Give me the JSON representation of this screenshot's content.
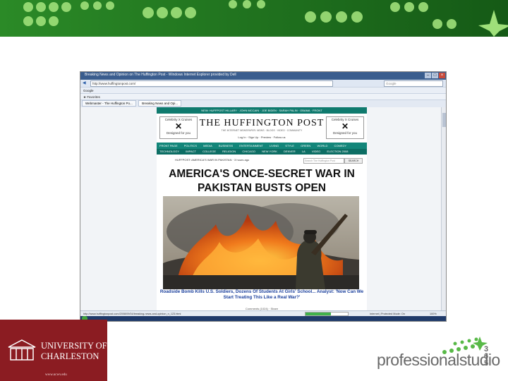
{
  "browser": {
    "title": "Breaking News and Opinion on The Huffington Post - Windows Internet Explorer provided by Dell",
    "address": "http://www.huffingtonpost.com/",
    "search_placeholder": "Google",
    "tabs": [
      {
        "label": "Webmaster - The Huffington Po..."
      },
      {
        "label": "Breaking News and Opi..."
      }
    ],
    "toolbar_label": "Google",
    "favorites_label": "Favorites",
    "status_url": "http://www.huffingtonpost.com/2008/09/04/breaking-news-and-opinion_n_123.html",
    "zone": "Internet | Protected Mode: On",
    "zoom": "100%",
    "load_progress": 0.6
  },
  "site": {
    "top_nav": "NEW: HUFFPOST HILLARY · JOHN MCCAIN · JOE BIDEN · SARAH PALIN · OBAMA · FRONT",
    "ads": [
      {
        "brand": "Celebrity X Cruises",
        "line": "Designed for you"
      },
      {
        "brand": "Celebrity X Cruises",
        "line": "Designed for you"
      }
    ],
    "logo": "THE HUFFINGTON POST",
    "tagline": "THE INTERNET NEWSPAPER: NEWS · BLOGS · VIDEO · COMMUNITY",
    "login": "Log In · Sign Up · Preview · Follow us",
    "sections": [
      "FRONT PAGE",
      "POLITICS",
      "MEDIA",
      "BUSINESS",
      "ENTERTAINMENT",
      "LIVING",
      "STYLE",
      "GREEN",
      "WORLD",
      "COMEDY"
    ],
    "subsections": [
      "TECHNOLOGY",
      "IMPACT",
      "COLLEGE",
      "RELIGION",
      "CHICAGO",
      "NEW YORK",
      "DENVER",
      "LA",
      "VIDEO",
      "ELECTION 2008"
    ],
    "ticker": "HUFFPOST: AMERICA'S WAR IN PAKISTAN · 3 hours ago",
    "search_placeholder": "Search The Huffington Post",
    "search_button": "SEARCH",
    "headline": "AMERICA'S ONCE-SECRET WAR IN PAKISTAN BUSTS OPEN",
    "subhead": "Roadside Bomb Kills U.S. Soldiers, Dozens Of Students At Girls' School... Analyst: 'Now Can We Start Treating This Like a Real War?'",
    "comments": "Comments (1024) · Share"
  },
  "footer": {
    "university_name": "UNIVERSITY OF\nCHARLESTON",
    "university_url": "www.ucwv.edu",
    "brand": "professionalstudio",
    "brand_number": "365"
  },
  "colors": {
    "banner": "#1e6e1e",
    "huffpost_teal": "#13867a",
    "university_red": "#8b1c22",
    "headline_link": "#1a3f9c"
  }
}
